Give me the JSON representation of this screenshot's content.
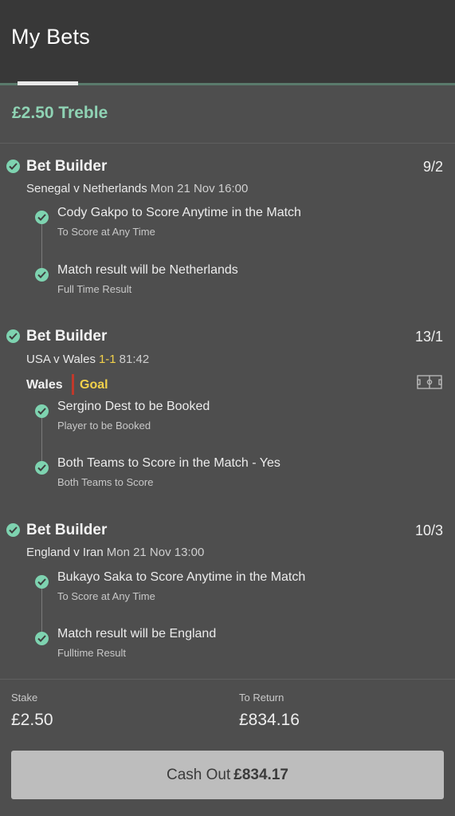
{
  "header": {
    "title": "My Bets"
  },
  "bet": {
    "type": "£2.50 Treble"
  },
  "legs": [
    {
      "title": "Bet Builder",
      "odds": "9/2",
      "match": "Senegal v Netherlands",
      "time": "Mon 21 Nov 16:00",
      "selections": [
        {
          "name": "Cody Gakpo to Score Anytime in the Match",
          "market": "To Score at Any Time"
        },
        {
          "name": "Match result will be Netherlands",
          "market": "Full Time Result"
        }
      ]
    },
    {
      "title": "Bet Builder",
      "odds": "13/1",
      "match": "USA v Wales",
      "score": "1-1",
      "clock": "81:42",
      "event": {
        "team": "Wales",
        "type": "Goal"
      },
      "selections": [
        {
          "name": "Sergino Dest to be Booked",
          "market": "Player to be Booked"
        },
        {
          "name": "Both Teams to Score in the Match - Yes",
          "market": "Both Teams to Score"
        }
      ]
    },
    {
      "title": "Bet Builder",
      "odds": "10/3",
      "match": "England v Iran",
      "time": "Mon 21 Nov 13:00",
      "selections": [
        {
          "name": "Bukayo Saka to Score Anytime in the Match",
          "market": "To Score at Any Time"
        },
        {
          "name": "Match result will be England",
          "market": "Fulltime Result"
        }
      ]
    }
  ],
  "footer": {
    "stake_label": "Stake",
    "stake_value": "£2.50",
    "return_label": "To Return",
    "return_value": "£834.16",
    "cashout_label": "Cash Out",
    "cashout_amount": "£834.17"
  },
  "colors": {
    "accent_green": "#7ed3b0",
    "bet_type_green": "#8fd3b4",
    "live_yellow": "#f2d14a",
    "goal_red": "#c0392b"
  },
  "icons": [
    "check-circle-icon",
    "pitch-icon"
  ]
}
